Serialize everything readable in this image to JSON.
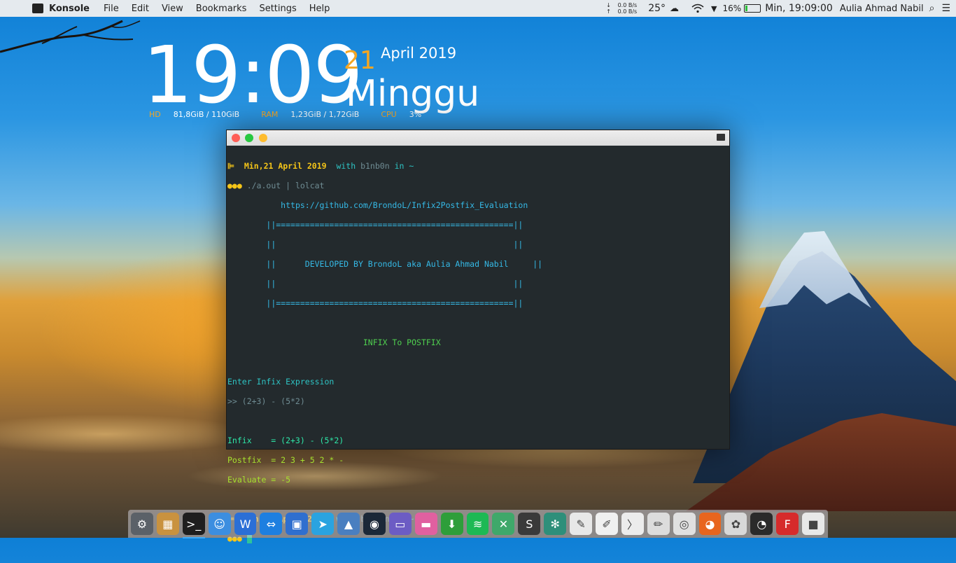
{
  "menubar": {
    "app_name": "Konsole",
    "menus": [
      "File",
      "Edit",
      "View",
      "Bookmarks",
      "Settings",
      "Help"
    ],
    "net_down": "0.0 B/s",
    "net_up": "0.0 B/s",
    "temperature": "25°",
    "battery_pct": "16%",
    "battery_level": 0.16,
    "clock": "Min, 19:09:00",
    "user": "Aulia Ahmad Nabil"
  },
  "widget": {
    "time": "19:09",
    "day": "21",
    "month_year": "April 2019",
    "weekday": "Minggu",
    "hd_label": "HD",
    "hd_value": "81,8GiB / 110GiB",
    "ram_label": "RAM",
    "ram_value": "1,23GiB / 1,72GiB",
    "cpu_label": "CPU",
    "cpu_value": "3%"
  },
  "terminal": {
    "prompt_date": "Min,21 April 2019",
    "prompt_with": "with",
    "prompt_user": "b1nb0n",
    "prompt_in": "in ~",
    "command": "./a.out | lolcat",
    "url": "https://github.com/BrondoL/Infix2Postfix_Evaluation",
    "border_line": "||=================================================||",
    "empty_row": "||                                                 ||",
    "developed_row": "||      DEVELOPED BY BrondoL aka Aulia Ahmad Nabil     ||",
    "heading": "INFIX To POSTFIX",
    "enter_label": "Enter Infix Expression",
    "input_line": ">> (2+3) - (5*2)",
    "infix_line": "Infix    = (2+3) - (5*2)",
    "postfix_line": "Postfix  = 2 3 + 5 2 * -",
    "evaluate_line": "Evaluate = -5"
  },
  "dock": {
    "items": [
      {
        "name": "system-settings-icon",
        "color": "#5b6168",
        "glyph": "⚙"
      },
      {
        "name": "package-icon",
        "color": "#c9923f",
        "glyph": "▦"
      },
      {
        "name": "terminal-icon",
        "color": "#1e1e1e",
        "glyph": ">_",
        "active": true
      },
      {
        "name": "finder-icon",
        "color": "#3c8ee0",
        "glyph": "☺"
      },
      {
        "name": "word-icon",
        "color": "#2b6fd6",
        "glyph": "W"
      },
      {
        "name": "teamviewer-icon",
        "color": "#1d7fe0",
        "glyph": "⇔"
      },
      {
        "name": "app-store-icon",
        "color": "#2f6fcf",
        "glyph": "▣"
      },
      {
        "name": "telegram-icon",
        "color": "#2aa3e0",
        "glyph": "➤"
      },
      {
        "name": "image-viewer-icon",
        "color": "#4a7fc0",
        "glyph": "▲"
      },
      {
        "name": "steam-icon",
        "color": "#1b2838",
        "glyph": "◉"
      },
      {
        "name": "gameboy-icon",
        "color": "#6c5cc4",
        "glyph": "▭"
      },
      {
        "name": "folder-pink-icon",
        "color": "#e060a0",
        "glyph": "▬"
      },
      {
        "name": "download-icon",
        "color": "#2e9e3a",
        "glyph": "⬇"
      },
      {
        "name": "spotify-icon",
        "color": "#1db954",
        "glyph": "≋"
      },
      {
        "name": "tools-icon",
        "color": "#3fa86a",
        "glyph": "✕"
      },
      {
        "name": "sublime-icon",
        "color": "#3a3a3a",
        "glyph": "S"
      },
      {
        "name": "plant-icon",
        "color": "#2e8f7a",
        "glyph": "✻"
      },
      {
        "name": "notes-icon",
        "color": "#e8e8e8",
        "glyph": "✎"
      },
      {
        "name": "editor-icon",
        "color": "#f0f0f0",
        "glyph": "✐"
      },
      {
        "name": "feather-icon",
        "color": "#ececec",
        "glyph": "〉"
      },
      {
        "name": "draw-icon",
        "color": "#dcdcdc",
        "glyph": "✏"
      },
      {
        "name": "chrome-icon",
        "color": "#e0e0e0",
        "glyph": "◎"
      },
      {
        "name": "firefox-icon",
        "color": "#e8651e",
        "glyph": "◕"
      },
      {
        "name": "photos-icon",
        "color": "#d8d8d8",
        "glyph": "✿"
      },
      {
        "name": "dashboard-icon",
        "color": "#2a2a2a",
        "glyph": "◔"
      },
      {
        "name": "flash-icon",
        "color": "#d62b2b",
        "glyph": "F"
      },
      {
        "name": "recorder-icon",
        "color": "#e8e8e8",
        "glyph": "■"
      }
    ]
  }
}
